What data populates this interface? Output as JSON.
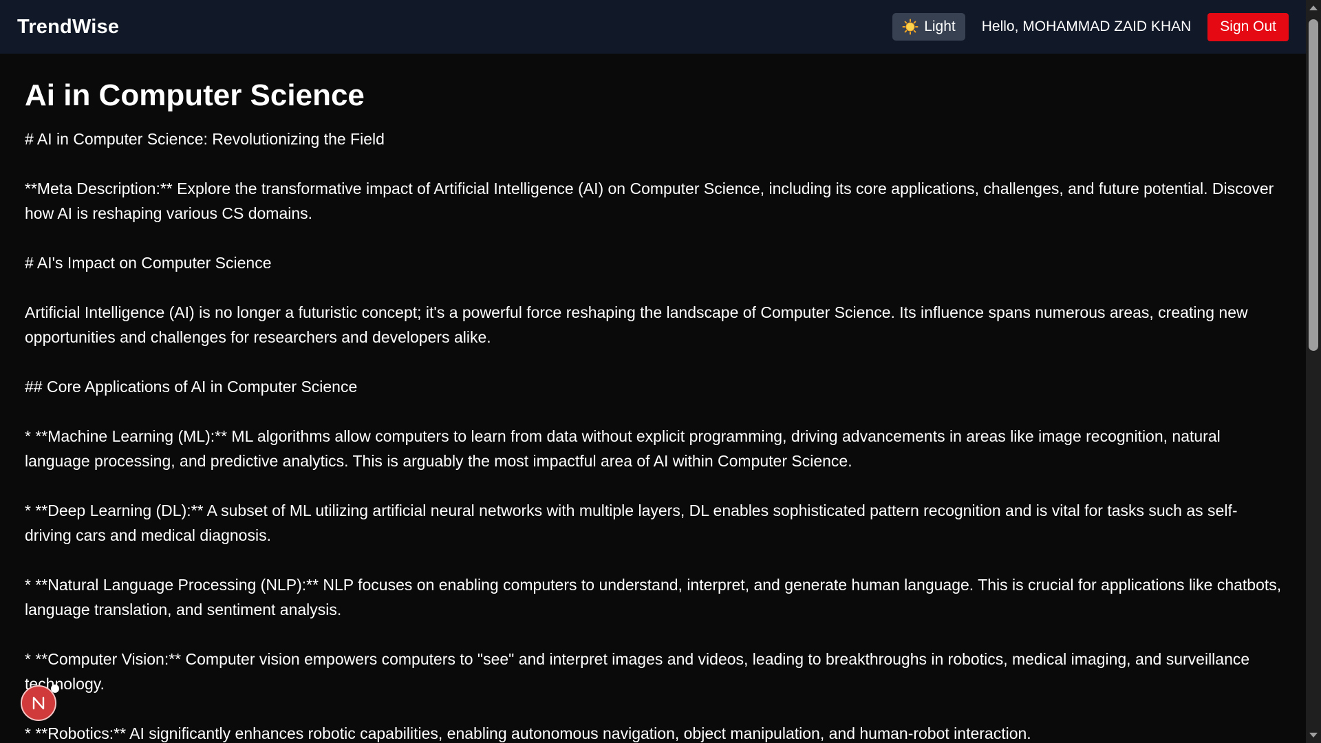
{
  "navbar": {
    "brand": "TrendWise",
    "theme_toggle_label": "Light",
    "theme_icon": "sun-icon",
    "greeting": "Hello, MOHAMMAD ZAID KHAN",
    "signout_label": "Sign Out"
  },
  "article": {
    "title": "Ai in Computer Science",
    "paragraphs": [
      "# AI in Computer Science: Revolutionizing the Field",
      "**Meta Description:** Explore the transformative impact of Artificial Intelligence (AI) on Computer Science, including its core applications, challenges, and future potential.  Discover how AI is reshaping various CS domains.",
      "# AI's Impact on Computer Science",
      "Artificial Intelligence (AI) is no longer a futuristic concept; it's a powerful force reshaping the landscape of Computer Science.  Its influence spans numerous areas, creating new opportunities and challenges for researchers and developers alike.",
      "## Core Applications of AI in Computer Science",
      "* **Machine Learning (ML):**  ML algorithms allow computers to learn from data without explicit programming, driving advancements in areas like image recognition, natural language processing, and predictive analytics.  This is arguably the most impactful area of AI within Computer Science.",
      "* **Deep Learning (DL):** A subset of ML utilizing artificial neural networks with multiple layers, DL enables sophisticated pattern recognition and is vital for tasks such as self-driving cars and medical diagnosis.",
      "* **Natural Language Processing (NLP):** NLP focuses on enabling computers to understand, interpret, and generate human language. This is crucial for applications like chatbots, language translation, and sentiment analysis.",
      "* **Computer Vision:**  Computer vision empowers computers to \"see\" and interpret images and videos, leading to breakthroughs in robotics, medical imaging, and surveillance technology.",
      "* **Robotics:** AI significantly enhances robotic capabilities, enabling autonomous navigation, object manipulation, and human-robot interaction."
    ]
  },
  "dev_badge": {
    "letter": "N"
  },
  "colors": {
    "navbar_bg": "#111827",
    "page_bg": "#0a0a0a",
    "signout_bg": "#e50914",
    "toggle_bg": "#374151",
    "badge_bg": "#d03a3a"
  }
}
